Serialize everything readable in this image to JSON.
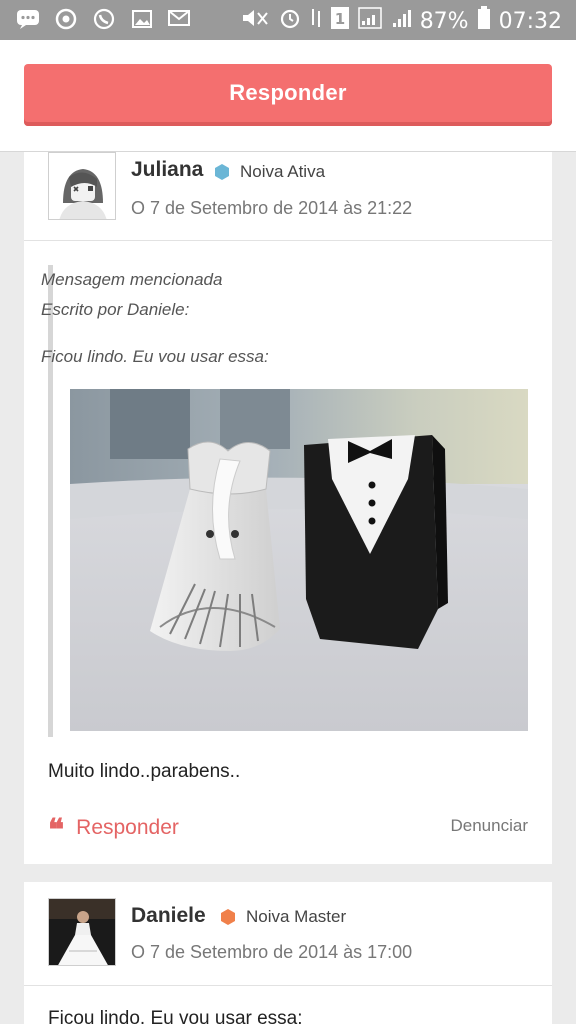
{
  "status_bar": {
    "battery": "87%",
    "time": "07:32"
  },
  "topbar": {
    "reply_label": "Responder"
  },
  "posts": [
    {
      "author": "Juliana",
      "role": "Noiva Ativa",
      "role_color": "#6bb6d6",
      "date": "O 7 de Setembro de 2014 às 21:22",
      "quote_header": "Mensagem mencionada",
      "quote_author": "Escrito por Daniele:",
      "quote_text": "Ficou lindo. Eu vou usar essa:",
      "body": "Muito lindo..parabens..",
      "reply_label": "Responder",
      "report_label": "Denunciar"
    },
    {
      "author": "Daniele",
      "role": "Noiva Master",
      "role_color": "#f0804a",
      "date": "O 7 de Setembro de 2014 às 17:00",
      "body_preview": "Ficou lindo. Eu vou usar essa:"
    }
  ],
  "colors": {
    "accent": "#f46f6f",
    "link": "#e46464"
  }
}
